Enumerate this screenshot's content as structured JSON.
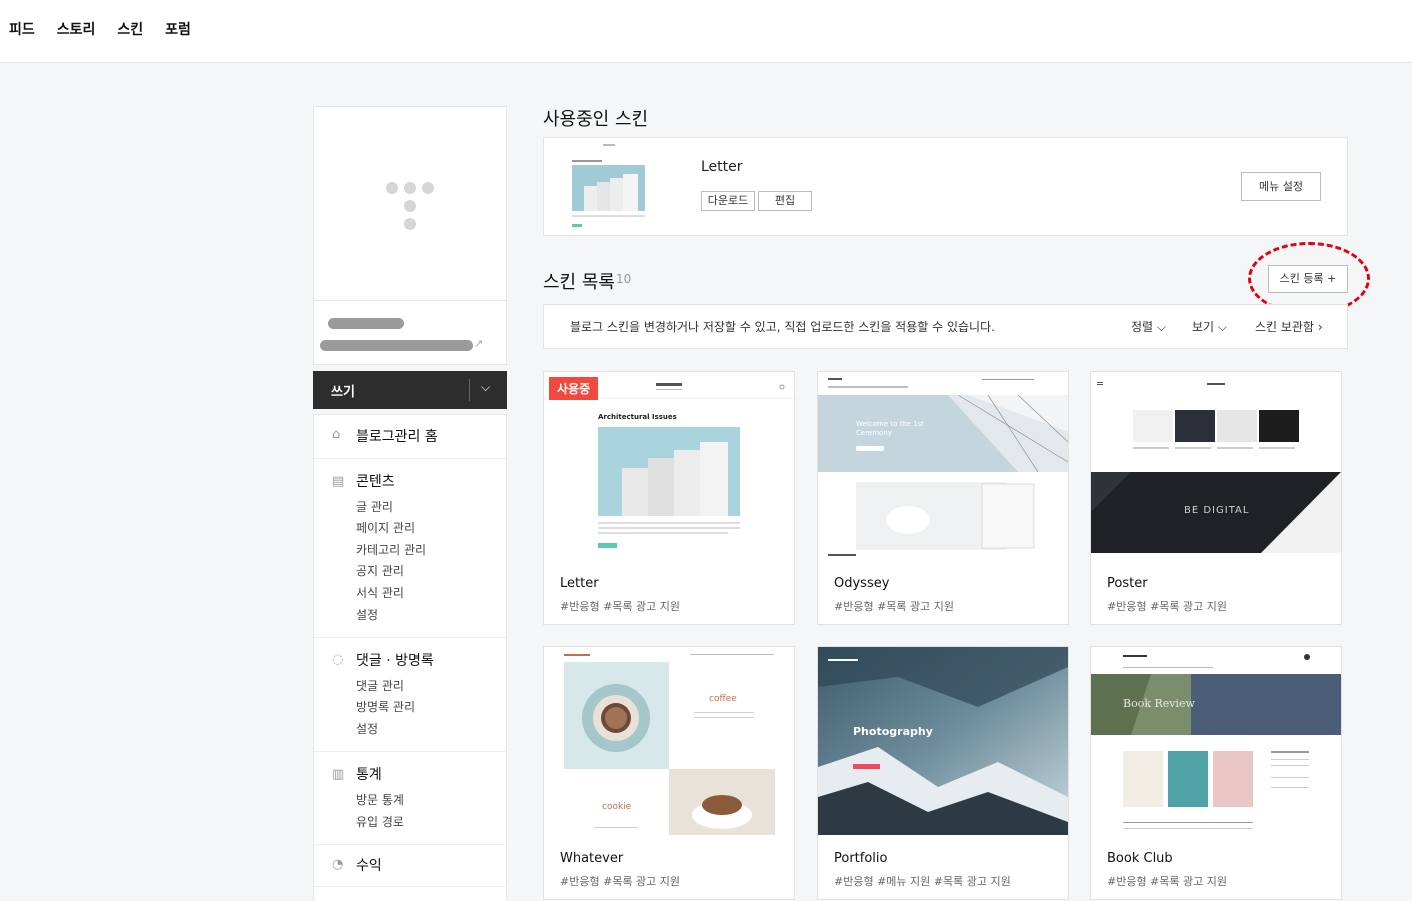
{
  "topnav": [
    "피드",
    "스토리",
    "스킨",
    "포럼"
  ],
  "sidebar": {
    "write_label": "쓰기",
    "home_label": "블로그관리 홈",
    "sections": [
      {
        "title": "콘텐츠",
        "items": [
          "글 관리",
          "페이지 관리",
          "카테고리 관리",
          "공지 관리",
          "서식 관리",
          "설정"
        ]
      },
      {
        "title": "댓글 · 방명록",
        "items": [
          "댓글 관리",
          "방명록 관리",
          "설정"
        ]
      },
      {
        "title": "통계",
        "items": [
          "방문 통계",
          "유입 경로"
        ]
      },
      {
        "title": "수익",
        "items": []
      }
    ]
  },
  "current": {
    "heading": "사용중인 스킨",
    "name": "Letter",
    "download_label": "다운로드",
    "edit_label": "편집",
    "menu_label": "메뉴 설정"
  },
  "list": {
    "heading": "스킨 목록",
    "count": "10",
    "register_label": "스킨 등록 +",
    "info": "블로그 스킨을 변경하거나 저장할 수 있고, 직접 업로드한 스킨을 적용할 수 있습니다.",
    "sort_label": "정렬 ⌵",
    "view_label": "보기 ⌵",
    "archive_label": "스킨 보관함 ›",
    "in_use_badge": "사용중"
  },
  "skins": [
    {
      "name": "Letter",
      "tags": "#반응형   #목록 광고 지원",
      "preview_text": "Architectural Issues"
    },
    {
      "name": "Odyssey",
      "tags": "#반응형   #목록 광고 지원",
      "preview_text": "Welcome to the 1st Ceremony"
    },
    {
      "name": "Poster",
      "tags": "#반응형   #목록 광고 지원",
      "preview_text": "BE DIGITAL"
    },
    {
      "name": "Whatever",
      "tags": "#반응형   #목록 광고 지원",
      "preview_text": "coffee",
      "preview_text2": "cookie"
    },
    {
      "name": "Portfolio",
      "tags": "#반응형   #메뉴 지원   #목록 광고 지원",
      "preview_text": "Photography"
    },
    {
      "name": "Book Club",
      "tags": "#반응형   #목록 광고 지원",
      "preview_text": "Book Review"
    }
  ],
  "colors": {
    "accent_red": "#f04a3f",
    "highlight": "#e0000e",
    "dark": "#2d2d2d"
  }
}
